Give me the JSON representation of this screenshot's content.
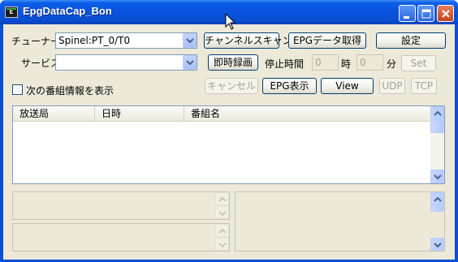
{
  "window": {
    "title": "EpgDataCap_Bon",
    "icon": "app-icon",
    "icon_glyph": "E"
  },
  "tuner": {
    "label": "チューナー",
    "value": "Spinel:PT_0/T0"
  },
  "service": {
    "label": "サービス",
    "value": ""
  },
  "buttons": {
    "channel_scan": "チャンネルスキャン",
    "epg_fetch": "EPGデータ取得",
    "settings": "設定",
    "instant_record": "即時録画",
    "set": "Set",
    "cancel": "キャンセル",
    "epg_view": "EPG表示",
    "view": "View",
    "udp": "UDP",
    "tcp": "TCP"
  },
  "stop_time": {
    "label": "停止時間",
    "hour_value": "0",
    "hour_unit": "時",
    "minute_value": "0",
    "minute_unit": "分"
  },
  "next_program": {
    "label": "次の番組情報を表示",
    "checked": false
  },
  "program_list": {
    "columns": [
      "放送局",
      "日時",
      "番組名"
    ]
  }
}
